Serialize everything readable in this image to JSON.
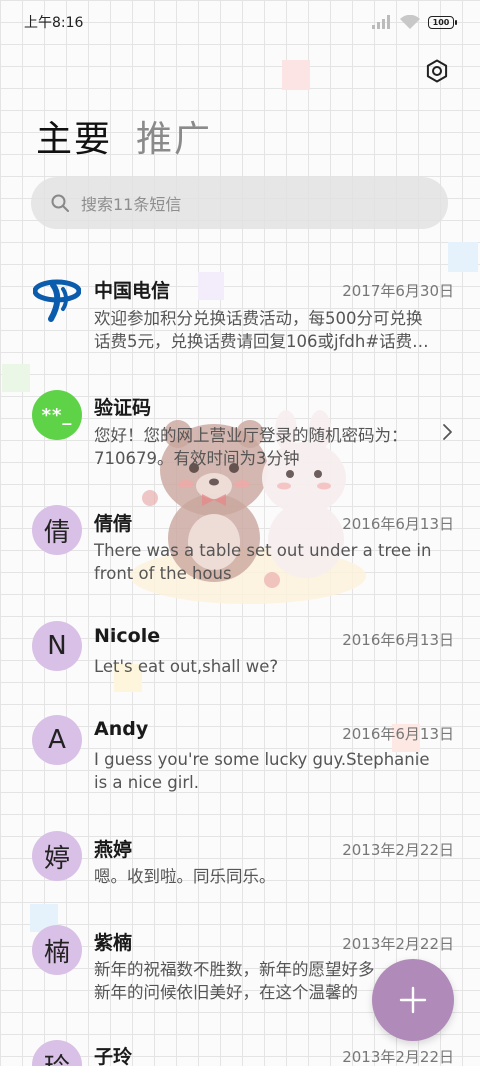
{
  "status_bar": {
    "time": "上午8:16",
    "battery": "100"
  },
  "tabs": [
    {
      "label": "主要",
      "active": true
    },
    {
      "label": "推广",
      "active": false
    }
  ],
  "search": {
    "placeholder": "搜索11条短信"
  },
  "messages": [
    {
      "sender": "中国电信",
      "date": "2017年6月30日",
      "line1": "欢迎参加积分兑换话费活动，每500分可兑换",
      "line2": "话费5元，兑换话费请回复106或jfdh#话费…",
      "avatar_icon": "china-telecom-logo"
    },
    {
      "sender": "验证码",
      "date": "",
      "line1": "您好！您的网上营业厅登录的随机密码为：",
      "line2": "710679。有效时间为3分钟",
      "avatar_text": "**_"
    },
    {
      "sender": "倩倩",
      "date": "2016年6月13日",
      "line1": "There was a table set out under a tree in",
      "line2": "front of the hous",
      "avatar_text": "倩"
    },
    {
      "sender": "Nicole",
      "date": "2016年6月13日",
      "line1": "Let's eat out,shall we?",
      "line2": "",
      "avatar_text": "N"
    },
    {
      "sender": "Andy",
      "date": "2016年6月13日",
      "line1": "I guess you're some lucky guy.Stephanie",
      "line2": "is a nice girl.",
      "avatar_text": "A"
    },
    {
      "sender": "燕婷",
      "date": "2013年2月22日",
      "line1": "嗯。收到啦。同乐同乐。",
      "line2": "",
      "avatar_text": "婷"
    },
    {
      "sender": "紫楠",
      "date": "2013年2月22日",
      "line1": "新年的祝福数不胜数，新年的愿望好多",
      "line2": "新年的问候依旧美好，在这个温馨的",
      "avatar_text": "楠"
    },
    {
      "sender": "子玲",
      "date": "2013年2月22日",
      "line1": "",
      "line2": "",
      "avatar_text": "玲"
    }
  ],
  "colors": {
    "avatar_purple": "#d9c0e6",
    "verify_green": "#5ed347",
    "fab": "#b08ab8",
    "telecom_blue": "#0b5cad"
  },
  "icons": [
    "settings-icon",
    "search-icon",
    "chevron-right-icon",
    "compose-plus-icon",
    "signal-icon",
    "wifi-icon",
    "battery-icon"
  ]
}
